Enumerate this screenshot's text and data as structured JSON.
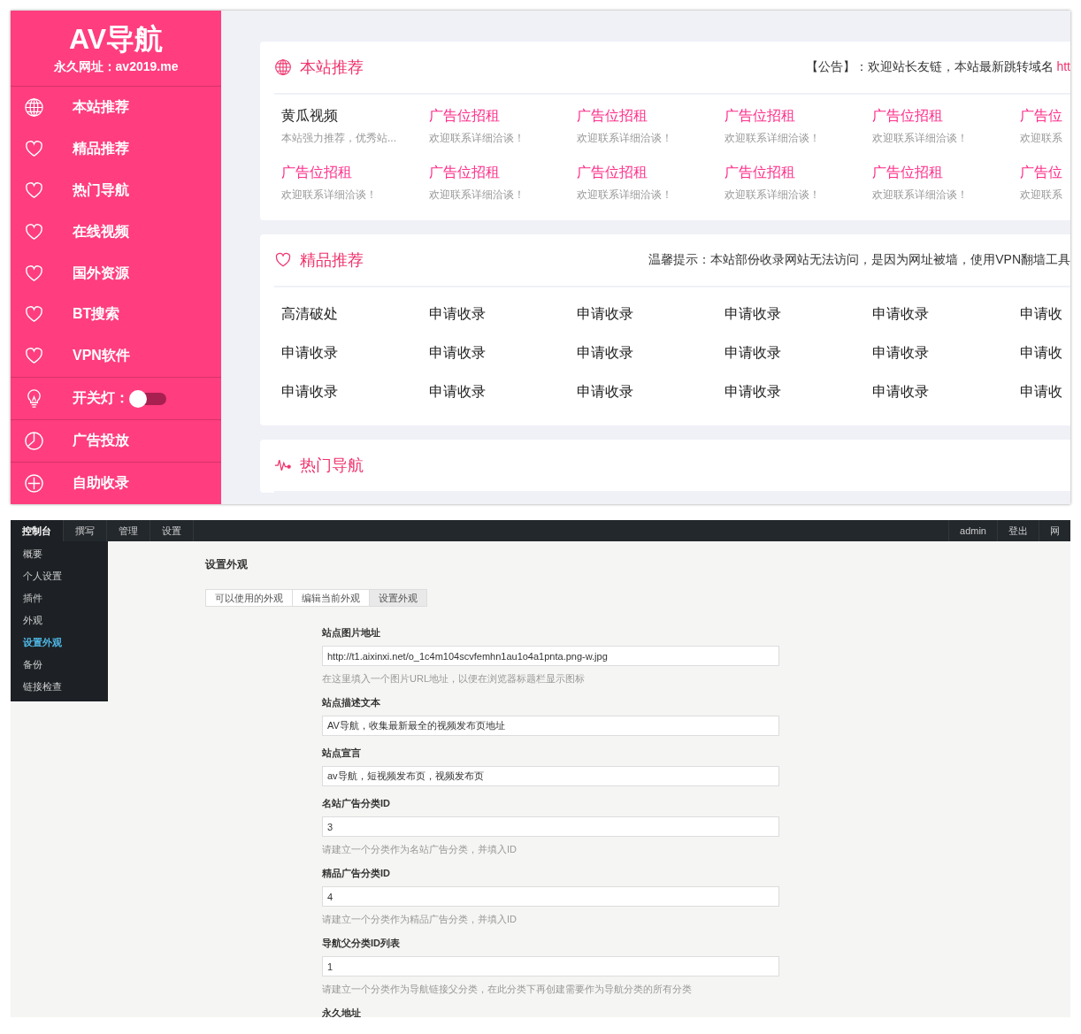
{
  "site": {
    "logo": "AV导航",
    "subtitle": "永久网址：av2019.me",
    "menu": [
      {
        "kind": "globe",
        "label": "本站推荐"
      },
      {
        "kind": "heart",
        "label": "精品推荐"
      },
      {
        "kind": "heart",
        "label": "热门导航"
      },
      {
        "kind": "heart",
        "label": "在线视频"
      },
      {
        "kind": "heart",
        "label": "国外资源"
      },
      {
        "kind": "heart",
        "label": "BT搜索"
      },
      {
        "kind": "heart",
        "label": "VPN软件"
      }
    ],
    "toggle": {
      "label": "开关灯：",
      "on": false
    },
    "menu_bottom": [
      {
        "kind": "pie",
        "label": "广告投放"
      },
      {
        "kind": "plus",
        "label": "自助收录"
      }
    ]
  },
  "sections": [
    {
      "kind": "ads",
      "title": "本站推荐",
      "notice": "【公告】：欢迎站长友链，本站最新跳转域名 ",
      "notice_link": "htt",
      "items": [
        {
          "kind": "site",
          "name": "黄瓜视频",
          "desc": "本站强力推荐，优秀站..."
        },
        {
          "kind": "ad",
          "name": "广告位招租",
          "desc": "欢迎联系详细洽谈！"
        },
        {
          "kind": "ad",
          "name": "广告位招租",
          "desc": "欢迎联系详细洽谈！"
        },
        {
          "kind": "ad",
          "name": "广告位招租",
          "desc": "欢迎联系详细洽谈！"
        },
        {
          "kind": "ad",
          "name": "广告位招租",
          "desc": "欢迎联系详细洽谈！"
        },
        {
          "kind": "ad",
          "name": "广告位",
          "desc": "欢迎联系"
        },
        {
          "kind": "ad",
          "name": "广告位招租",
          "desc": "欢迎联系详细洽谈！"
        },
        {
          "kind": "ad",
          "name": "广告位招租",
          "desc": "欢迎联系详细洽谈！"
        },
        {
          "kind": "ad",
          "name": "广告位招租",
          "desc": "欢迎联系详细洽谈！"
        },
        {
          "kind": "ad",
          "name": "广告位招租",
          "desc": "欢迎联系详细洽谈！"
        },
        {
          "kind": "ad",
          "name": "广告位招租",
          "desc": "欢迎联系详细洽谈！"
        },
        {
          "kind": "ad",
          "name": "广告位",
          "desc": "欢迎联系"
        }
      ]
    },
    {
      "kind": "links",
      "title": "精品推荐",
      "notice": "温馨提示：本站部份收录网站无法访问，是因为网址被墙，使用VPN翻墙工具",
      "items": [
        "高清破处",
        "申请收录",
        "申请收录",
        "申请收录",
        "申请收录",
        "申请收",
        "申请收录",
        "申请收录",
        "申请收录",
        "申请收录",
        "申请收录",
        "申请收",
        "申请收录",
        "申请收录",
        "申请收录",
        "申请收录",
        "申请收录",
        "申请收"
      ]
    },
    {
      "kind": "header",
      "title": "热门导航"
    }
  ],
  "admin": {
    "tabs": [
      {
        "label": "控制台",
        "selected": true
      },
      {
        "label": "撰写",
        "selected": false
      },
      {
        "label": "管理",
        "selected": false
      },
      {
        "label": "设置",
        "selected": false
      }
    ],
    "user_links": [
      "admin",
      "登出",
      "网"
    ],
    "submenu": [
      {
        "label": "概要",
        "selected": false
      },
      {
        "label": "个人设置",
        "selected": false
      },
      {
        "label": "插件",
        "selected": false
      },
      {
        "label": "外观",
        "selected": false
      },
      {
        "label": "设置外观",
        "selected": true
      },
      {
        "label": "备份",
        "selected": false
      },
      {
        "label": "链接检查",
        "selected": false
      }
    ],
    "title": "设置外观",
    "subtabs": [
      {
        "label": "可以使用的外观",
        "selected": false
      },
      {
        "label": "编辑当前外观",
        "selected": false
      },
      {
        "label": "设置外观",
        "selected": true
      }
    ],
    "fields": [
      {
        "label": "站点图片地址",
        "value": "http://t1.aixinxi.net/o_1c4m104scvfemhn1au1o4a1pnta.png-w.jpg",
        "hint": "在这里填入一个图片URL地址，以便在浏览器标题栏显示图标"
      },
      {
        "label": "站点描述文本",
        "value": "AV导航，收集最新最全的视频发布页地址"
      },
      {
        "label": "站点宣言",
        "value": "av导航，短视频发布页，视频发布页"
      },
      {
        "label": "名站广告分类ID",
        "value": "3",
        "hint": "请建立一个分类作为名站广告分类，并填入ID"
      },
      {
        "label": "精品广告分类ID",
        "value": "4",
        "hint": "请建立一个分类作为精品广告分类，并填入ID"
      },
      {
        "label": "导航父分类ID列表",
        "value": "1",
        "hint": "请建立一个分类作为导航链接父分类，在此分类下再创建需要作为导航分类的所有分类"
      },
      {
        "label": "永久地址"
      }
    ]
  }
}
